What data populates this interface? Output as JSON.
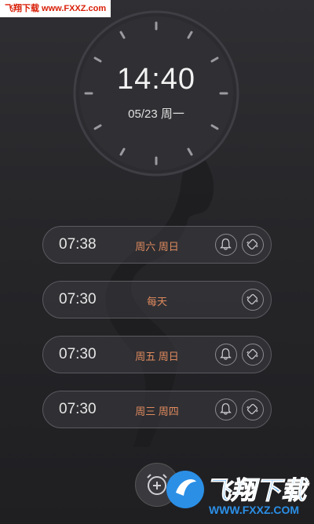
{
  "watermark": {
    "text": "飞翔下载 www.FXXZ.com"
  },
  "clock": {
    "time": "14:40",
    "date": "05/23 周一"
  },
  "alarms": [
    {
      "time": "07:38",
      "days": "周六 周日",
      "bell": true
    },
    {
      "time": "07:30",
      "days": "每天",
      "bell": false
    },
    {
      "time": "07:30",
      "days": "周五 周日",
      "bell": true
    },
    {
      "time": "07:30",
      "days": "周三 周四",
      "bell": true
    }
  ],
  "logo": {
    "text": "飞翔下载",
    "url": "WWW.FXXZ.COM"
  },
  "colors": {
    "accent": "#e08a5e",
    "background": "#2a2a2e",
    "logo": "#2b8fe6"
  }
}
